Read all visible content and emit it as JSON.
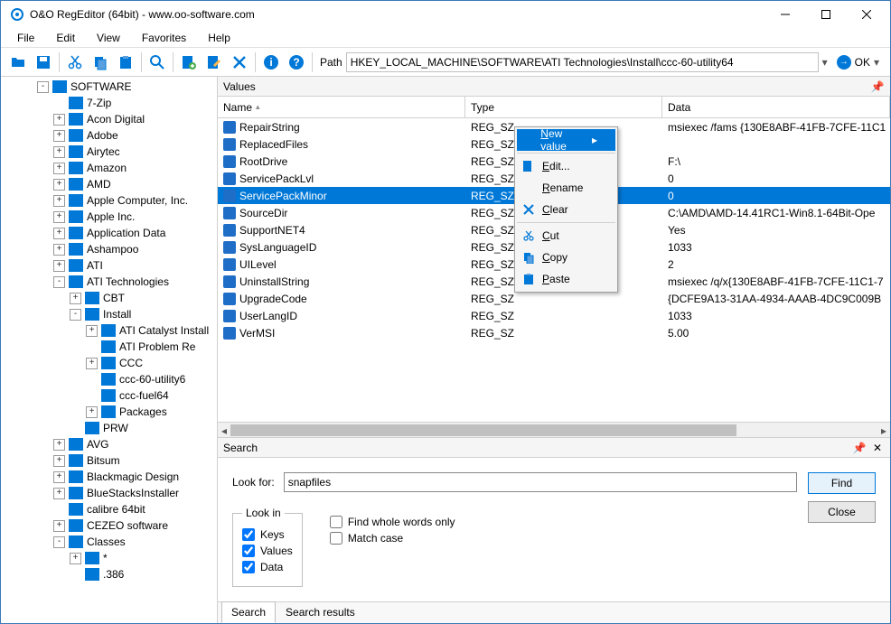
{
  "window": {
    "title": "O&O RegEditor (64bit) - www.oo-software.com"
  },
  "menu": {
    "items": [
      "File",
      "Edit",
      "View",
      "Favorites",
      "Help"
    ]
  },
  "path": {
    "label": "Path",
    "value": "HKEY_LOCAL_MACHINE\\SOFTWARE\\ATI Technologies\\Install\\ccc-60-utility64",
    "ok": "OK"
  },
  "tree": {
    "root": {
      "label": "SOFTWARE",
      "level": 2,
      "exp": "-"
    },
    "items": [
      {
        "label": "7-Zip",
        "level": 3,
        "exp": ""
      },
      {
        "label": "Acon Digital",
        "level": 3,
        "exp": "+"
      },
      {
        "label": "Adobe",
        "level": 3,
        "exp": "+"
      },
      {
        "label": "Airytec",
        "level": 3,
        "exp": "+"
      },
      {
        "label": "Amazon",
        "level": 3,
        "exp": "+"
      },
      {
        "label": "AMD",
        "level": 3,
        "exp": "+"
      },
      {
        "label": "Apple Computer, Inc.",
        "level": 3,
        "exp": "+"
      },
      {
        "label": "Apple Inc.",
        "level": 3,
        "exp": "+"
      },
      {
        "label": "Application Data",
        "level": 3,
        "exp": "+"
      },
      {
        "label": "Ashampoo",
        "level": 3,
        "exp": "+"
      },
      {
        "label": "ATI",
        "level": 3,
        "exp": "+"
      },
      {
        "label": "ATI Technologies",
        "level": 3,
        "exp": "-"
      },
      {
        "label": "CBT",
        "level": 4,
        "exp": "+"
      },
      {
        "label": "Install",
        "level": 4,
        "exp": "-"
      },
      {
        "label": "ATI Catalyst Install",
        "level": 5,
        "exp": "+"
      },
      {
        "label": "ATI Problem Re",
        "level": 5,
        "exp": ""
      },
      {
        "label": "CCC",
        "level": 5,
        "exp": "+"
      },
      {
        "label": "ccc-60-utility6",
        "level": 5,
        "exp": ""
      },
      {
        "label": "ccc-fuel64",
        "level": 5,
        "exp": ""
      },
      {
        "label": "Packages",
        "level": 5,
        "exp": "+"
      },
      {
        "label": "PRW",
        "level": 4,
        "exp": ""
      },
      {
        "label": "AVG",
        "level": 3,
        "exp": "+"
      },
      {
        "label": "Bitsum",
        "level": 3,
        "exp": "+"
      },
      {
        "label": "Blackmagic Design",
        "level": 3,
        "exp": "+"
      },
      {
        "label": "BlueStacksInstaller",
        "level": 3,
        "exp": "+"
      },
      {
        "label": "calibre 64bit",
        "level": 3,
        "exp": ""
      },
      {
        "label": "CEZEO software",
        "level": 3,
        "exp": "+"
      },
      {
        "label": "Classes",
        "level": 3,
        "exp": "-"
      },
      {
        "label": "*",
        "level": 4,
        "exp": "+"
      },
      {
        "label": ".386",
        "level": 4,
        "exp": ""
      }
    ]
  },
  "panels": {
    "values_title": "Values",
    "search_title": "Search"
  },
  "grid": {
    "cols": {
      "name": "Name",
      "type": "Type",
      "data": "Data"
    },
    "rows": [
      {
        "name": "RepairString",
        "type": "REG_SZ",
        "data": "msiexec /fams {130E8ABF-41FB-7CFE-11C1"
      },
      {
        "name": "ReplacedFiles",
        "type": "REG_SZ",
        "data": ""
      },
      {
        "name": "RootDrive",
        "type": "REG_SZ",
        "data": "F:\\"
      },
      {
        "name": "ServicePackLvl",
        "type": "REG_SZ",
        "data": "0"
      },
      {
        "name": "ServicePackMinor",
        "type": "REG_SZ",
        "data": "0",
        "sel": true
      },
      {
        "name": "SourceDir",
        "type": "REG_SZ",
        "data": "C:\\AMD\\AMD-14.41RC1-Win8.1-64Bit-Ope"
      },
      {
        "name": "SupportNET4",
        "type": "REG_SZ",
        "data": "Yes"
      },
      {
        "name": "SysLanguageID",
        "type": "REG_SZ",
        "data": "1033"
      },
      {
        "name": "UILevel",
        "type": "REG_SZ",
        "data": "2"
      },
      {
        "name": "UninstallString",
        "type": "REG_SZ",
        "data": "msiexec /q/x{130E8ABF-41FB-7CFE-11C1-7"
      },
      {
        "name": "UpgradeCode",
        "type": "REG_SZ",
        "data": "{DCFE9A13-31AA-4934-AAAB-4DC9C009B"
      },
      {
        "name": "UserLangID",
        "type": "REG_SZ",
        "data": "1033"
      },
      {
        "name": "VerMSI",
        "type": "REG_SZ",
        "data": "5.00"
      }
    ]
  },
  "context": {
    "items": [
      {
        "label": "New value",
        "icon": "",
        "hl": true,
        "sub": true
      },
      {
        "sep": true
      },
      {
        "label": "Edit...",
        "icon": "edit"
      },
      {
        "label": "Rename",
        "icon": ""
      },
      {
        "label": "Clear",
        "icon": "clear"
      },
      {
        "sep": true
      },
      {
        "label": "Cut",
        "icon": "cut"
      },
      {
        "label": "Copy",
        "icon": "copy"
      },
      {
        "label": "Paste",
        "icon": "paste"
      }
    ]
  },
  "search": {
    "look_for_label": "Look for:",
    "look_for_value": "snapfiles",
    "look_in_label": "Look in",
    "keys": "Keys",
    "values": "Values",
    "data": "Data",
    "whole": "Find whole words only",
    "match": "Match case",
    "find": "Find",
    "close": "Close",
    "tab_search": "Search",
    "tab_results": "Search results"
  }
}
